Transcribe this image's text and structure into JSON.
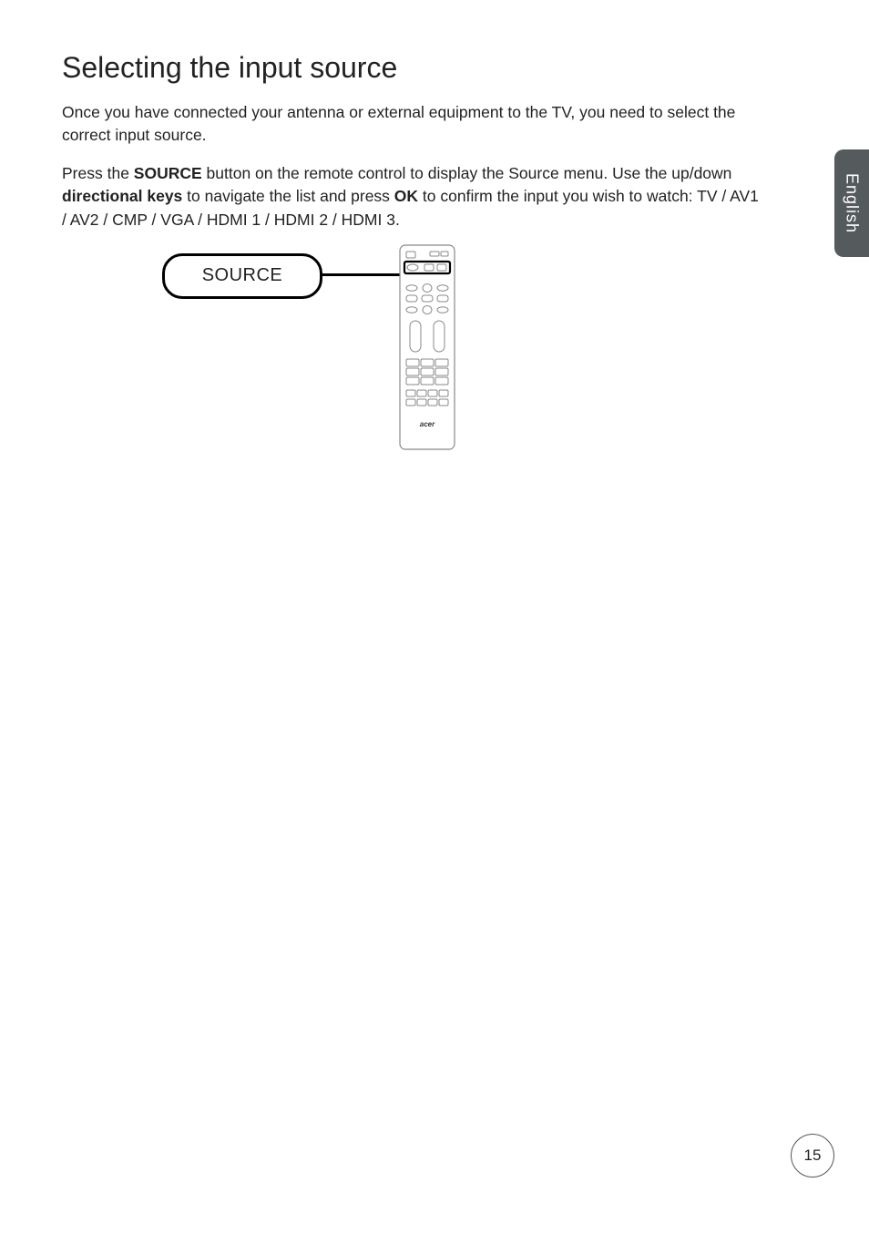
{
  "heading": "Selecting the input source",
  "p1": "Once you have connected your antenna or external equipment to the TV, you need to select the correct input source.",
  "p2_a": "Press the ",
  "p2_source": "SOURCE",
  "p2_b": " button on the remote control to display the Source menu. Use the up/down ",
  "p2_dir": "directional keys",
  "p2_c": " to navigate the list and press ",
  "p2_ok": "OK",
  "p2_d": " to confirm the input you wish to watch: TV / AV1 / AV2 / CMP / VGA / HDMI 1 / HDMI 2 / HDMI 3.",
  "source_label": "SOURCE",
  "side_tab": "English",
  "page_number": "15",
  "remote_brand": "acer"
}
